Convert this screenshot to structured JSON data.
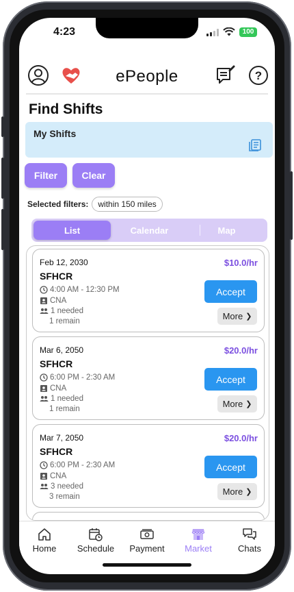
{
  "status": {
    "time": "4:23",
    "battery": "100"
  },
  "header": {
    "title": "ePeople",
    "icons": [
      "profile-icon",
      "heart-hands-icon",
      "compose-message-icon",
      "help-icon"
    ]
  },
  "page": {
    "title": "Find Shifts"
  },
  "my_shifts": {
    "label": "My Shifts",
    "icon": "list-icon"
  },
  "actions": {
    "filter_label": "Filter",
    "clear_label": "Clear"
  },
  "filters": {
    "label": "Selected filters:",
    "chips": [
      "within 150 miles"
    ]
  },
  "view_tabs": {
    "list": "List",
    "calendar": "Calendar",
    "map": "Map",
    "active": "List"
  },
  "shifts": [
    {
      "date": "Feb 12, 2030",
      "rate": "$10.0/hr",
      "name": "SFHCR",
      "time": "4:00 AM - 12:30 PM",
      "role": "CNA",
      "needed": "1 needed",
      "remain": "1 remain",
      "accept": "Accept",
      "more": "More"
    },
    {
      "date": "Mar 6, 2050",
      "rate": "$20.0/hr",
      "name": "SFHCR",
      "time": "6:00 PM - 2:30 AM",
      "role": "CNA",
      "needed": "1 needed",
      "remain": "1 remain",
      "accept": "Accept",
      "more": "More"
    },
    {
      "date": "Mar 7, 2050",
      "rate": "$20.0/hr",
      "name": "SFHCR",
      "time": "6:00 PM - 2:30 AM",
      "role": "CNA",
      "needed": "3 needed",
      "remain": "3 remain",
      "accept": "Accept",
      "more": "More"
    }
  ],
  "tab_bar": [
    {
      "label": "Home",
      "icon": "home-icon"
    },
    {
      "label": "Schedule",
      "icon": "calendar-clock-icon"
    },
    {
      "label": "Payment",
      "icon": "cash-icon"
    },
    {
      "label": "Market",
      "icon": "store-icon",
      "active": true
    },
    {
      "label": "Chats",
      "icon": "chat-bubbles-icon"
    }
  ],
  "colors": {
    "accent": "#9b7ef5",
    "accept": "#2a96f0",
    "rate": "#7b4fe0",
    "my_shifts_bg": "#d4ecfa",
    "heart": "#e8504b"
  }
}
